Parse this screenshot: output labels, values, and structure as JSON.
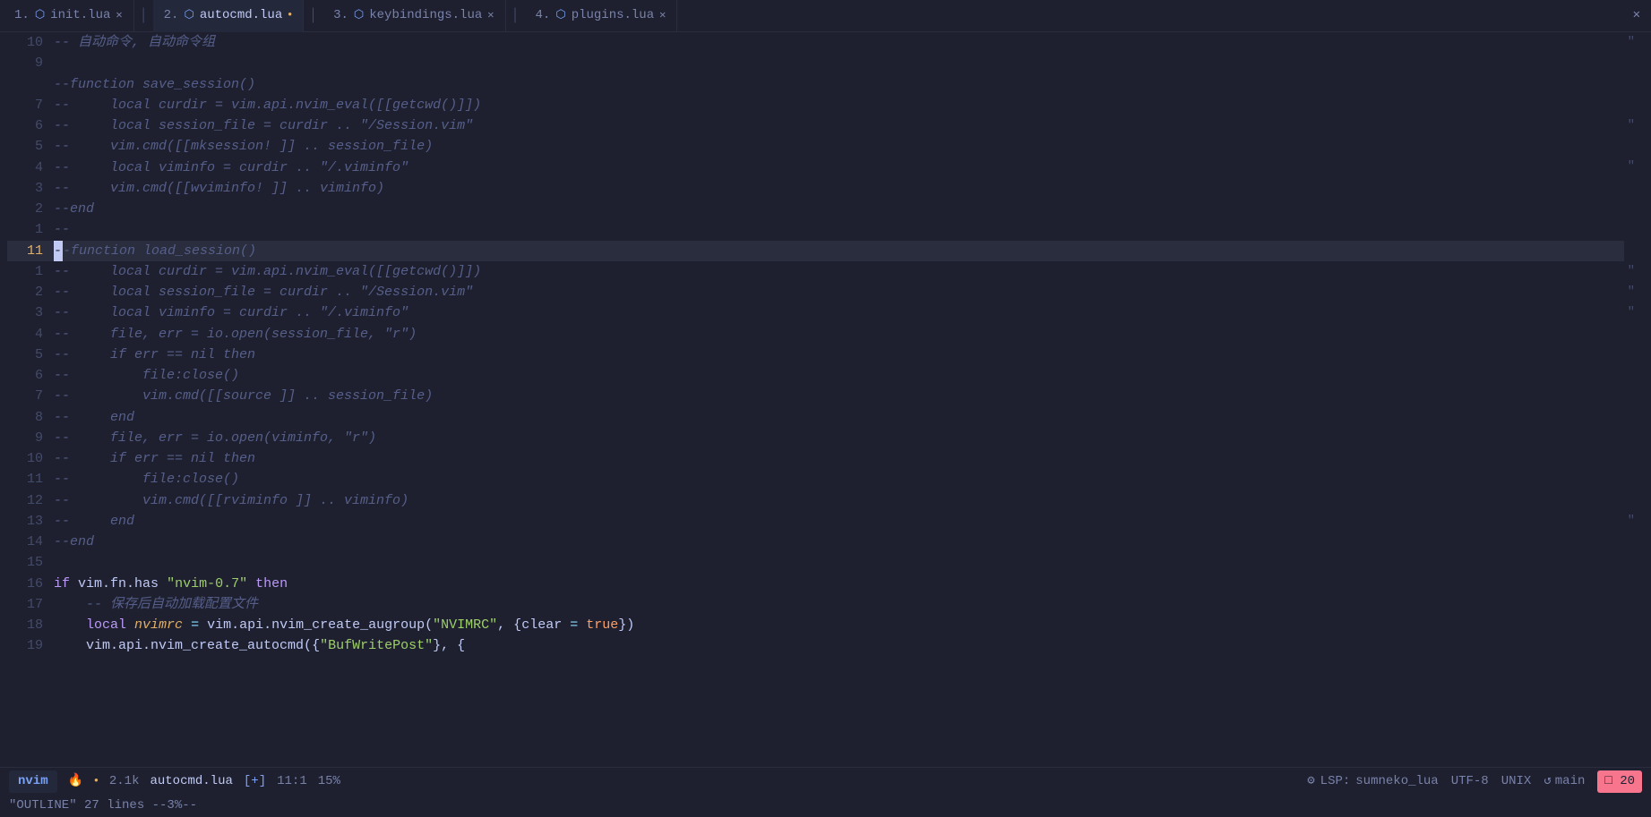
{
  "tabs": [
    {
      "num": "1.",
      "icon": "lua",
      "name": "init.lua",
      "modified": false,
      "active": false,
      "closable": true
    },
    {
      "num": "2.",
      "icon": "lua",
      "name": "autocmd.lua",
      "modified": true,
      "active": true,
      "closable": false
    },
    {
      "num": "3.",
      "icon": "lua",
      "name": "keybindings.lua",
      "modified": false,
      "active": false,
      "closable": true
    },
    {
      "num": "4.",
      "icon": "lua",
      "name": "plugins.lua",
      "modified": false,
      "active": false,
      "closable": true
    }
  ],
  "lines": [
    {
      "num": "10",
      "content": "-- 自动命令, 自动命令组",
      "type": "comment_zh"
    },
    {
      "num": "9",
      "content": "",
      "type": "empty"
    },
    {
      "num": "",
      "content": "--function save_session()",
      "type": "comment"
    },
    {
      "num": "7",
      "content": "--     local curdir = vim.api.nvim_eval([[getcwd()]])",
      "type": "comment"
    },
    {
      "num": "6",
      "content": "--     local session_file = curdir .. \"/Session.vim\"",
      "type": "comment"
    },
    {
      "num": "5",
      "content": "--     vim.cmd([[mksession! ]] .. session_file)",
      "type": "comment"
    },
    {
      "num": "4",
      "content": "--     local viminfo = curdir .. \"/.viminfo\"",
      "type": "comment"
    },
    {
      "num": "3",
      "content": "--     vim.cmd([[wviminfo! ]] .. viminfo)",
      "type": "comment"
    },
    {
      "num": "2",
      "content": "--end",
      "type": "comment"
    },
    {
      "num": "1",
      "content": "--",
      "type": "comment"
    },
    {
      "num": "11",
      "content": "--function load_session()",
      "type": "comment_current",
      "current": true
    },
    {
      "num": "1",
      "content": "--     local curdir = vim.api.nvim_eval([[getcwd()]])",
      "type": "comment"
    },
    {
      "num": "2",
      "content": "--     local session_file = curdir .. \"/Session.vim\"",
      "type": "comment"
    },
    {
      "num": "3",
      "content": "--     local viminfo = curdir .. \"/.viminfo\"",
      "type": "comment"
    },
    {
      "num": "4",
      "content": "--     file, err = io.open(session_file, \"r\")",
      "type": "comment"
    },
    {
      "num": "5",
      "content": "--     if err == nil then",
      "type": "comment"
    },
    {
      "num": "6",
      "content": "--         file:close()",
      "type": "comment"
    },
    {
      "num": "7",
      "content": "--         vim.cmd([[source ]] .. session_file)",
      "type": "comment"
    },
    {
      "num": "8",
      "content": "--     end",
      "type": "comment"
    },
    {
      "num": "9",
      "content": "--     file, err = io.open(viminfo, \"r\")",
      "type": "comment"
    },
    {
      "num": "10",
      "content": "--     if err == nil then",
      "type": "comment"
    },
    {
      "num": "11",
      "content": "--         file:close()",
      "type": "comment"
    },
    {
      "num": "12",
      "content": "--         vim.cmd([[rviminfo ]] .. viminfo)",
      "type": "comment"
    },
    {
      "num": "13",
      "content": "--     end",
      "type": "comment"
    },
    {
      "num": "14",
      "content": "--end",
      "type": "comment"
    },
    {
      "num": "15",
      "content": "",
      "type": "empty"
    },
    {
      "num": "16",
      "content": "if vim.fn.has \"nvim-0.7\" then",
      "type": "code_if"
    },
    {
      "num": "17",
      "content": "    -- 保存后自动加载配置文件",
      "type": "comment_zh_indent"
    },
    {
      "num": "18",
      "content": "    local nvimrc = vim.api.nvim_create_augroup(\"NVIMRC\", {clear = true})",
      "type": "code_local"
    },
    {
      "num": "19",
      "content": "    vim.api.nvim_create_autocmd({\"BufWritePost\"}, {",
      "type": "code_api"
    }
  ],
  "statusbar": {
    "mode": "nvim",
    "flame_icon": "🔥",
    "dot_icon": "●",
    "size": "2.1k",
    "filename": "autocmd.lua",
    "modified": "[+]",
    "pos": "11:1",
    "percent": "15%",
    "lsp_icon": "⚙",
    "lsp_label": "LSP:",
    "lsp_name": "sumneko_lua",
    "encoding": "UTF-8",
    "fileformat": "UNIX",
    "branch_icon": "↺",
    "branch_name": "main",
    "err_icon": "□",
    "err_count": "20"
  },
  "bottomline": {
    "content": "\"OUTLINE\"  27 lines  --3%--"
  }
}
